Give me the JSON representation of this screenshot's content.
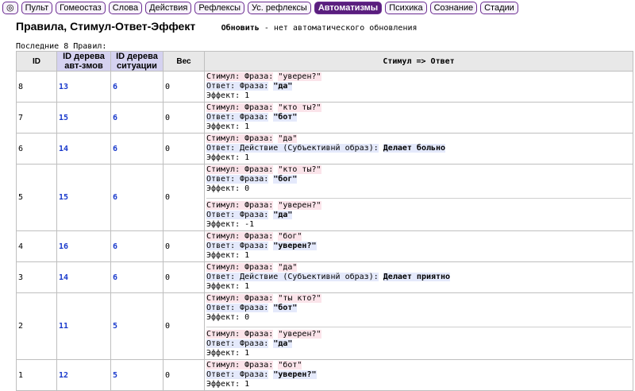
{
  "nav": {
    "items": [
      "◎",
      "Пульт",
      "Гомеостаз",
      "Слова",
      "Действия",
      "Рефлексы",
      "Ус. рефлексы",
      "Автоматизмы",
      "Психика",
      "Сознание",
      "Стадии"
    ],
    "active_index": 7
  },
  "header": {
    "title": "Правила, Стимул-Ответ-Эффект",
    "refresh_label": "Обновить",
    "refresh_note": "- нет автоматического обновления"
  },
  "count_text": "Последние 8 Правил:",
  "table": {
    "headers": {
      "id": "ID",
      "tree_aut": "ID дерева авт-змов",
      "tree_sit": "ID дерева ситуации",
      "weight": "Вес",
      "rule": "Стимул => Ответ"
    },
    "rows": [
      {
        "id": "8",
        "tree_aut": "13",
        "tree_sit": "6",
        "weight": "0",
        "blocks": [
          {
            "stim_label": "Стимул: Фраза:",
            "stim_value": "\"уверен?\"",
            "resp_label": "Ответ: Фраза:",
            "resp_value": "\"да\"",
            "effect": "Эффект: 1"
          }
        ]
      },
      {
        "id": "7",
        "tree_aut": "15",
        "tree_sit": "6",
        "weight": "0",
        "blocks": [
          {
            "stim_label": "Стимул: Фраза:",
            "stim_value": "\"кто ты?\"",
            "resp_label": "Ответ: Фраза:",
            "resp_value": "\"бот\"",
            "effect": "Эффект: 1"
          }
        ]
      },
      {
        "id": "6",
        "tree_aut": "14",
        "tree_sit": "6",
        "weight": "0",
        "blocks": [
          {
            "stim_label": "Стимул: Фраза:",
            "stim_value": "\"да\"",
            "resp_label": "Ответ: Действие (Субъективнй образ):",
            "resp_value": "Делает больно",
            "effect": "Эффект: 1"
          }
        ]
      },
      {
        "id": "5",
        "tree_aut": "15",
        "tree_sit": "6",
        "weight": "0",
        "blocks": [
          {
            "stim_label": "Стимул: Фраза:",
            "stim_value": "\"кто ты?\"",
            "resp_label": "Ответ: Фраза:",
            "resp_value": "\"бог\"",
            "effect": "Эффект: 0"
          },
          {
            "stim_label": "Стимул: Фраза:",
            "stim_value": "\"уверен?\"",
            "resp_label": "Ответ: Фраза:",
            "resp_value": "\"да\"",
            "effect": "Эффект: -1"
          }
        ]
      },
      {
        "id": "4",
        "tree_aut": "16",
        "tree_sit": "6",
        "weight": "0",
        "blocks": [
          {
            "stim_label": "Стимул: Фраза:",
            "stim_value": "\"бог\"",
            "resp_label": "Ответ: Фраза:",
            "resp_value": "\"уверен?\"",
            "effect": "Эффект: 1"
          }
        ]
      },
      {
        "id": "3",
        "tree_aut": "14",
        "tree_sit": "6",
        "weight": "0",
        "blocks": [
          {
            "stim_label": "Стимул: Фраза:",
            "stim_value": "\"да\"",
            "resp_label": "Ответ: Действие (Субъективнй образ):",
            "resp_value": "Делает приятно",
            "effect": "Эффект: 1"
          }
        ]
      },
      {
        "id": "2",
        "tree_aut": "11",
        "tree_sit": "5",
        "weight": "0",
        "blocks": [
          {
            "stim_label": "Стимул: Фраза:",
            "stim_value": "\"ты кто?\"",
            "resp_label": "Ответ: Фраза:",
            "resp_value": "\"бот\"",
            "effect": "Эффект: 0"
          },
          {
            "stim_label": "Стимул: Фраза:",
            "stim_value": "\"уверен?\"",
            "resp_label": "Ответ: Фраза:",
            "resp_value": "\"да\"",
            "effect": "Эффект: 1"
          }
        ]
      },
      {
        "id": "1",
        "tree_aut": "12",
        "tree_sit": "5",
        "weight": "0",
        "blocks": [
          {
            "stim_label": "Стимул: Фраза:",
            "stim_value": "\"бот\"",
            "resp_label": "Ответ: Фраза:",
            "resp_value": "\"уверен?\"",
            "effect": "Эффект: 1"
          }
        ]
      }
    ]
  },
  "colors": {
    "nav_active": "#5a1f7e",
    "nav_border": "#6b2c91",
    "link": "#1a3acc",
    "header_highlight": "#d5d2f0",
    "stimulus_bg": "#fbe4ea",
    "response_bg": "#e4e9fb"
  }
}
